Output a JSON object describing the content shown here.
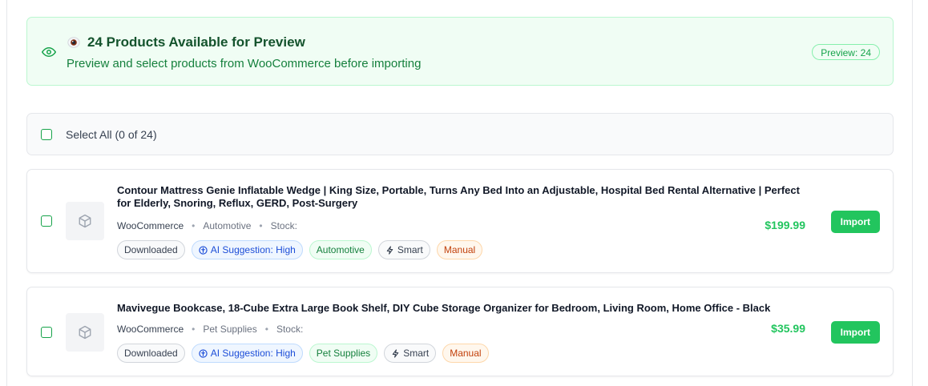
{
  "banner": {
    "title": "24 Products Available for Preview",
    "subtitle": "Preview and select products from WooCommerce before importing",
    "badge": "Preview: 24",
    "accent": "#16a34a"
  },
  "select_all": {
    "label": "Select All (0 of 24)"
  },
  "products": [
    {
      "title": "Contour Mattress Genie Inflatable Wedge | King Size, Portable, Turns Any Bed Into an Adjustable, Hospital Bed Rental Alternative | Perfect for Elderly, Snoring, Reflux, GERD, Post-Surgery",
      "source": "WooCommerce",
      "category": "Automotive",
      "stock": "Stock:",
      "price": "$199.99",
      "tags": {
        "downloaded": "Downloaded",
        "ai": "AI Suggestion: High",
        "category": "Automotive",
        "smart": "Smart",
        "manual": "Manual"
      },
      "import_label": "Import"
    },
    {
      "title": "Mavivegue Bookcase, 18-Cube Extra Large Book Shelf, DIY Cube Storage Organizer for Bedroom, Living Room, Home Office - Black",
      "source": "WooCommerce",
      "category": "Pet Supplies",
      "stock": "Stock:",
      "price": "$35.99",
      "tags": {
        "downloaded": "Downloaded",
        "ai": "AI Suggestion: High",
        "category": "Pet Supplies",
        "smart": "Smart",
        "manual": "Manual"
      },
      "import_label": "Import"
    }
  ],
  "icons": {
    "banner": "eye-icon",
    "title": "eye-emoji-icon",
    "thumb": "box-icon",
    "ai": "brain-icon",
    "smart": "lightning-icon"
  }
}
